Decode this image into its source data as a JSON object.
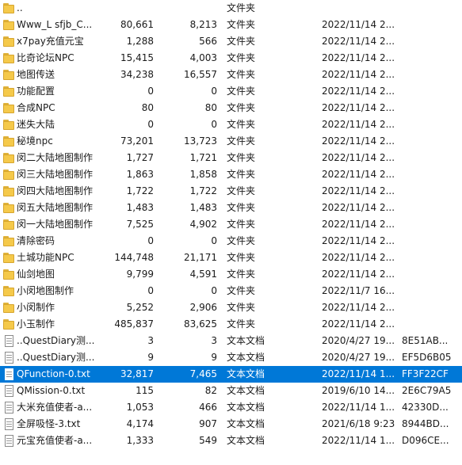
{
  "rows": [
    {
      "name": "..",
      "size": "",
      "packed": "",
      "type": "文件夹",
      "modified": "",
      "crc": "",
      "icon": "folder-icon",
      "selected": false
    },
    {
      "name": "Www_L sfjb_C...",
      "size": "80,661",
      "packed": "8,213",
      "type": "文件夹",
      "modified": "2022/11/14 2...",
      "crc": "",
      "icon": "folder-icon",
      "selected": false
    },
    {
      "name": "x7pay充值元宝",
      "size": "1,288",
      "packed": "566",
      "type": "文件夹",
      "modified": "2022/11/14 2...",
      "crc": "",
      "icon": "folder-icon",
      "selected": false
    },
    {
      "name": "比奇论坛NPC",
      "size": "15,415",
      "packed": "4,003",
      "type": "文件夹",
      "modified": "2022/11/14 2...",
      "crc": "",
      "icon": "folder-icon",
      "selected": false
    },
    {
      "name": "地图传送",
      "size": "34,238",
      "packed": "16,557",
      "type": "文件夹",
      "modified": "2022/11/14 2...",
      "crc": "",
      "icon": "folder-icon",
      "selected": false
    },
    {
      "name": "功能配置",
      "size": "0",
      "packed": "0",
      "type": "文件夹",
      "modified": "2022/11/14 2...",
      "crc": "",
      "icon": "folder-icon",
      "selected": false
    },
    {
      "name": "合成NPC",
      "size": "80",
      "packed": "80",
      "type": "文件夹",
      "modified": "2022/11/14 2...",
      "crc": "",
      "icon": "folder-icon",
      "selected": false
    },
    {
      "name": "迷失大陆",
      "size": "0",
      "packed": "0",
      "type": "文件夹",
      "modified": "2022/11/14 2...",
      "crc": "",
      "icon": "folder-icon",
      "selected": false
    },
    {
      "name": "秘境npc",
      "size": "73,201",
      "packed": "13,723",
      "type": "文件夹",
      "modified": "2022/11/14 2...",
      "crc": "",
      "icon": "folder-icon",
      "selected": false
    },
    {
      "name": "闵二大陆地图制作",
      "size": "1,727",
      "packed": "1,721",
      "type": "文件夹",
      "modified": "2022/11/14 2...",
      "crc": "",
      "icon": "folder-icon",
      "selected": false
    },
    {
      "name": "闵三大陆地图制作",
      "size": "1,863",
      "packed": "1,858",
      "type": "文件夹",
      "modified": "2022/11/14 2...",
      "crc": "",
      "icon": "folder-icon",
      "selected": false
    },
    {
      "name": "闵四大陆地图制作",
      "size": "1,722",
      "packed": "1,722",
      "type": "文件夹",
      "modified": "2022/11/14 2...",
      "crc": "",
      "icon": "folder-icon",
      "selected": false
    },
    {
      "name": "闵五大陆地图制作",
      "size": "1,483",
      "packed": "1,483",
      "type": "文件夹",
      "modified": "2022/11/14 2...",
      "crc": "",
      "icon": "folder-icon",
      "selected": false
    },
    {
      "name": "闵一大陆地图制作",
      "size": "7,525",
      "packed": "4,902",
      "type": "文件夹",
      "modified": "2022/11/14 2...",
      "crc": "",
      "icon": "folder-icon",
      "selected": false
    },
    {
      "name": "清除密码",
      "size": "0",
      "packed": "0",
      "type": "文件夹",
      "modified": "2022/11/14 2...",
      "crc": "",
      "icon": "folder-icon",
      "selected": false
    },
    {
      "name": "土城功能NPC",
      "size": "144,748",
      "packed": "21,171",
      "type": "文件夹",
      "modified": "2022/11/14 2...",
      "crc": "",
      "icon": "folder-icon",
      "selected": false
    },
    {
      "name": "仙剑地图",
      "size": "9,799",
      "packed": "4,591",
      "type": "文件夹",
      "modified": "2022/11/14 2...",
      "crc": "",
      "icon": "folder-icon",
      "selected": false
    },
    {
      "name": "小闵地图制作",
      "size": "0",
      "packed": "0",
      "type": "文件夹",
      "modified": "2022/11/7 16...",
      "crc": "",
      "icon": "folder-icon",
      "selected": false
    },
    {
      "name": "小闵制作",
      "size": "5,252",
      "packed": "2,906",
      "type": "文件夹",
      "modified": "2022/11/14 2...",
      "crc": "",
      "icon": "folder-icon",
      "selected": false
    },
    {
      "name": "小玉制作",
      "size": "485,837",
      "packed": "83,625",
      "type": "文件夹",
      "modified": "2022/11/14 2...",
      "crc": "",
      "icon": "folder-icon",
      "selected": false
    },
    {
      "name": "..QuestDiary测...",
      "size": "3",
      "packed": "3",
      "type": "文本文档",
      "modified": "2020/4/27 19...",
      "crc": "8E51AB...",
      "icon": "text-file-icon",
      "selected": false
    },
    {
      "name": "..QuestDiary测...",
      "size": "9",
      "packed": "9",
      "type": "文本文档",
      "modified": "2020/4/27 19...",
      "crc": "EF5D6B05",
      "icon": "text-file-icon",
      "selected": false
    },
    {
      "name": "QFunction-0.txt",
      "size": "32,817",
      "packed": "7,465",
      "type": "文本文档",
      "modified": "2022/11/14 1...",
      "crc": "FF3F22CF",
      "icon": "text-file-icon",
      "selected": true
    },
    {
      "name": "QMission-0.txt",
      "size": "115",
      "packed": "82",
      "type": "文本文档",
      "modified": "2019/6/10 14...",
      "crc": "2E6C79A5",
      "icon": "text-file-icon",
      "selected": false
    },
    {
      "name": "大米充值使者-a...",
      "size": "1,053",
      "packed": "466",
      "type": "文本文档",
      "modified": "2022/11/14 1...",
      "crc": "42330D...",
      "icon": "text-file-icon",
      "selected": false
    },
    {
      "name": "全屏吸怪-3.txt",
      "size": "4,174",
      "packed": "907",
      "type": "文本文档",
      "modified": "2021/6/18 9:23",
      "crc": "8944BD...",
      "icon": "text-file-icon",
      "selected": false
    },
    {
      "name": "元宝充值使者-a...",
      "size": "1,333",
      "packed": "549",
      "type": "文本文档",
      "modified": "2022/11/14 1...",
      "crc": "D096CE...",
      "icon": "text-file-icon",
      "selected": false
    }
  ],
  "colors": {
    "selection": "#0078d7",
    "folder": "#f5c94a",
    "text": "#1a1a1a"
  }
}
